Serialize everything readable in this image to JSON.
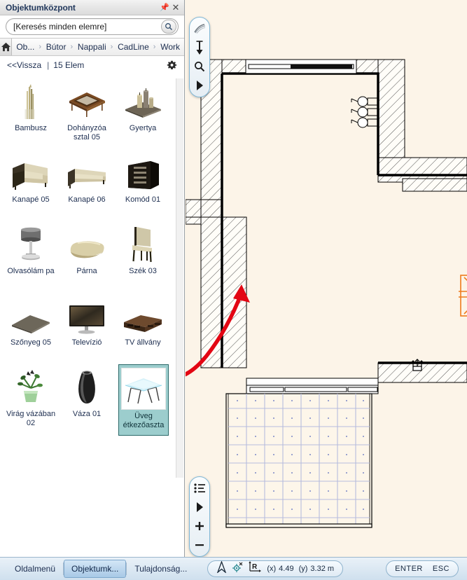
{
  "window": {
    "title": "Objektumközpont",
    "pin_icon": "pin-icon",
    "close_icon": "close-icon"
  },
  "search": {
    "value": "[Keresés minden elemre]",
    "placeholder": "[Keresés minden elemre]",
    "button_icon": "search-icon"
  },
  "breadcrumb": {
    "home_icon": "home-icon",
    "separator": "›",
    "items": [
      {
        "label": "Ob..."
      },
      {
        "label": "Bútor"
      },
      {
        "label": "Nappali"
      },
      {
        "label": "CadLine"
      },
      {
        "label": "Work"
      }
    ]
  },
  "info": {
    "back_label": "<<Vissza",
    "divider": "|",
    "count_label": "15 Elem",
    "gear_icon": "gear-icon"
  },
  "items": [
    {
      "label": "Bambusz",
      "icon": "bamboo-thumb",
      "selected": false
    },
    {
      "label": "Dohányzóa sztal 05",
      "icon": "coffee-table-thumb",
      "selected": false
    },
    {
      "label": "Gyertya",
      "icon": "candle-thumb",
      "selected": false
    },
    {
      "label": "Kanapé 05",
      "icon": "armchair-thumb",
      "selected": false
    },
    {
      "label": "Kanapé 06",
      "icon": "sofa-thumb",
      "selected": false
    },
    {
      "label": "Komód 01",
      "icon": "dresser-thumb",
      "selected": false
    },
    {
      "label": "Olvasólám pa",
      "icon": "reading-lamp-thumb",
      "selected": false
    },
    {
      "label": "Párna",
      "icon": "pillow-thumb",
      "selected": false
    },
    {
      "label": "Szék 03",
      "icon": "chair-thumb",
      "selected": false
    },
    {
      "label": "Szőnyeg 05",
      "icon": "carpet-thumb",
      "selected": false
    },
    {
      "label": "Televízió",
      "icon": "tv-thumb",
      "selected": false
    },
    {
      "label": "TV állvány",
      "icon": "tv-stand-thumb",
      "selected": false
    },
    {
      "label": "Virág vázában 02",
      "icon": "flower-vase-thumb",
      "selected": false
    },
    {
      "label": "Váza 01",
      "icon": "vase-thumb",
      "selected": false
    },
    {
      "label": "Üveg étkezőaszta",
      "icon": "glass-dining-table-thumb",
      "selected": true
    }
  ],
  "toolbar_top": [
    {
      "icon": "pan-swipe-icon"
    },
    {
      "icon": "move-vertical-icon"
    },
    {
      "icon": "zoom-icon"
    },
    {
      "icon": "play-arrow-icon"
    }
  ],
  "toolbar_bottom": [
    {
      "icon": "list-icon"
    },
    {
      "icon": "play-arrow-icon"
    },
    {
      "icon": "plus-icon"
    },
    {
      "icon": "minus-icon"
    }
  ],
  "bottom_tabs": [
    {
      "label": "Oldalmenü",
      "active": false
    },
    {
      "label": "Objektumk...",
      "active": true
    },
    {
      "label": "Tulajdonság...",
      "active": false
    }
  ],
  "status": {
    "compass_icon": "compass-north-icon",
    "snap_icon": "snap-point-icon",
    "ruler_icon": "relative-coord-icon",
    "x_label": "(x)",
    "x_value": "4.49",
    "y_label": "(y)",
    "y_value": "3.32 m"
  },
  "keys": [
    {
      "label": "ENTER"
    },
    {
      "label": "ESC"
    }
  ],
  "plan": {
    "wall_color": "#000000",
    "background": "#fcf4e8",
    "placed_object_color": "#ee7b1c",
    "tile_grid_color": "#b6bcdd",
    "arrow_color": "#e30613",
    "placed_object_name": "glass-dining-table-plan-symbol"
  }
}
